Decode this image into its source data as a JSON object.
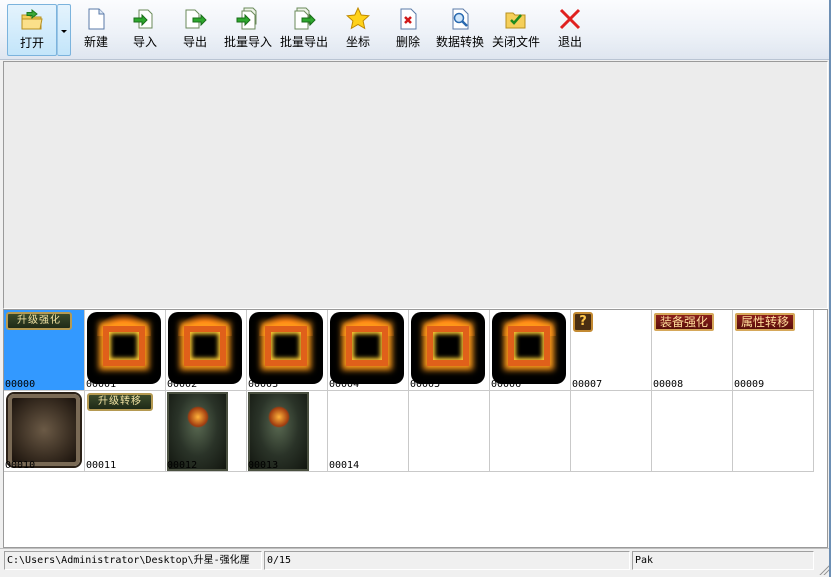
{
  "toolbar": {
    "open": "打开",
    "new": "新建",
    "import": "导入",
    "export": "导出",
    "batch_import": "批量导入",
    "batch_export": "批量导出",
    "coords": "坐标",
    "delete": "删除",
    "convert": "数据转换",
    "close_file": "关闭文件",
    "exit": "退出"
  },
  "grid": {
    "items": [
      {
        "label": "00000",
        "thumb": "banner",
        "text": "升级强化",
        "selected": true
      },
      {
        "label": "00001",
        "thumb": "fire-frame"
      },
      {
        "label": "00002",
        "thumb": "fire-frame"
      },
      {
        "label": "00003",
        "thumb": "fire-frame"
      },
      {
        "label": "00004",
        "thumb": "fire-frame"
      },
      {
        "label": "00005",
        "thumb": "fire-frame"
      },
      {
        "label": "00006",
        "thumb": "fire-frame"
      },
      {
        "label": "00007",
        "thumb": "question-icon",
        "text": "?"
      },
      {
        "label": "00008",
        "thumb": "text-button",
        "text": "装备强化"
      },
      {
        "label": "00009",
        "thumb": "text-button",
        "text": "属性转移"
      },
      {
        "label": "00010",
        "thumb": "stone-frame"
      },
      {
        "label": "00011",
        "thumb": "banner",
        "text": "升级转移"
      },
      {
        "label": "00012",
        "thumb": "dark-card"
      },
      {
        "label": "00013",
        "thumb": "dark-card"
      },
      {
        "label": "00014",
        "thumb": "empty"
      }
    ]
  },
  "statusbar": {
    "path": "C:\\Users\\Administrator\\Desktop\\升星-强化厘",
    "count": "0/15",
    "format": "Pak"
  },
  "colors": {
    "selection": "#3399ff",
    "toolbar_bg": "#eef2f8"
  }
}
